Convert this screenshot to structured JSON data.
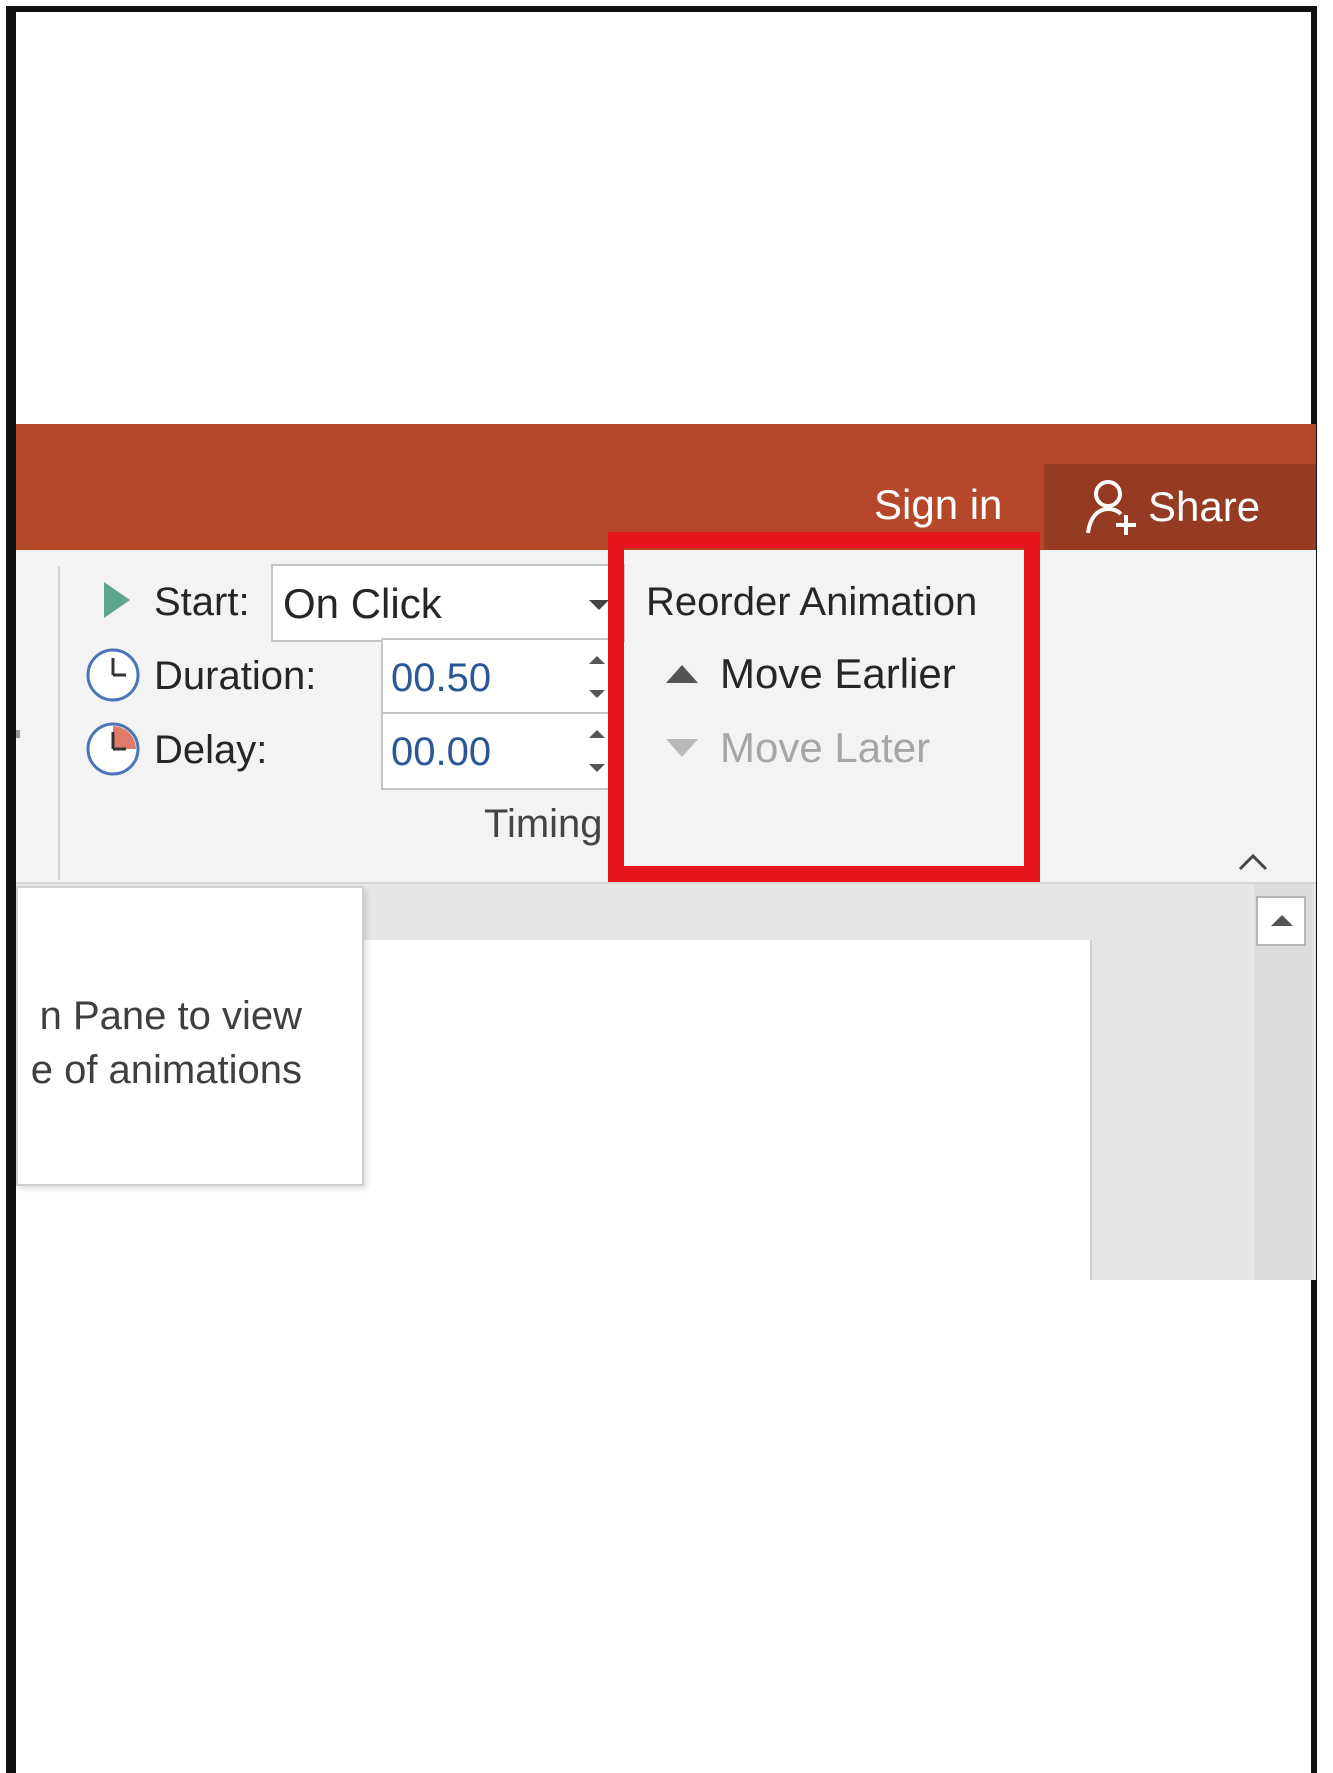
{
  "header": {
    "sign_in": "Sign in",
    "share": "Share"
  },
  "timing": {
    "start_label": "Start:",
    "start_value": "On Click",
    "duration_label": "Duration:",
    "duration_value": "00.50",
    "delay_label": "Delay:",
    "delay_value": "00.00",
    "group_label": "Timing"
  },
  "reorder": {
    "title": "Reorder Animation",
    "move_earlier": "Move Earlier",
    "move_later": "Move Later"
  },
  "tooltip": {
    "line1": "n Pane to view",
    "line2": "e of animations"
  },
  "colors": {
    "titlebar": "#b7472a",
    "share_button": "#953a23",
    "highlight": "#e8141e",
    "spinner_text": "#2b5797"
  },
  "icons": {
    "play": "play-icon",
    "duration": "clock-icon",
    "delay": "delay-clock-icon",
    "share": "person-add-icon"
  }
}
